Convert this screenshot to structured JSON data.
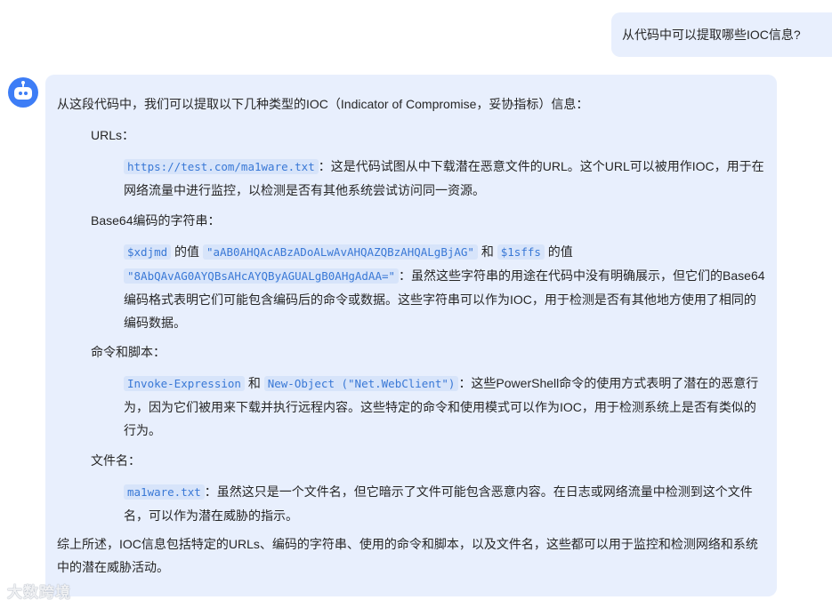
{
  "user_message": "从代码中可以提取哪些IOC信息?",
  "reply": {
    "intro": "从这段代码中，我们可以提取以下几种类型的IOC（Indicator of Compromise，妥协指标）信息：",
    "sections": [
      {
        "heading": "URLs：",
        "code1": "https://test.com/ma1ware.txt",
        "text1": "：这是代码试图从中下载潜在恶意文件的URL。这个URL可以被用作IOC，用于在网络流量中进行监控，以检测是否有其他系统尝试访问同一资源。"
      },
      {
        "heading": "Base64编码的字符串：",
        "code1": "$xdjmd",
        "text1": " 的值 ",
        "code2": "\"aAB0AHQAcABzADoALwAvAHQAZQBzAHQALgBjAG\"",
        "text2": " 和 ",
        "code3": "$1sffs",
        "text3": " 的值 ",
        "code4": "\"8AbQAvAG0AYQBsAHcAYQByAGUALgB0AHgAdAA=\"",
        "text4": "：虽然这些字符串的用途在代码中没有明确展示，但它们的Base64编码格式表明它们可能包含编码后的命令或数据。这些字符串可以作为IOC，用于检测是否有其他地方使用了相同的编码数据。"
      },
      {
        "heading": "命令和脚本：",
        "code1": "Invoke-Expression",
        "text1": " 和 ",
        "code2": "New-Object (\"Net.WebClient\")",
        "text2": "：这些PowerShell命令的使用方式表明了潜在的恶意行为，因为它们被用来下载并执行远程内容。这些特定的命令和使用模式可以作为IOC，用于检测系统上是否有类似的行为。"
      },
      {
        "heading": "文件名：",
        "code1": "ma1ware.txt",
        "text1": "：虽然这只是一个文件名，但它暗示了文件可能包含恶意内容。在日志或网络流量中检测到这个文件名，可以作为潜在威胁的指示。"
      }
    ],
    "summary": "综上所述，IOC信息包括特定的URLs、编码的字符串、使用的命令和脚本，以及文件名，这些都可以用于监控和检测网络和系统中的潜在威胁活动。"
  },
  "watermark": "大数跨境",
  "colors": {
    "bubble_bg": "#e8effd",
    "avatar": "#3d7df6",
    "code_text": "#3978d6",
    "code_bg": "#d7e4fa"
  },
  "icons": {
    "avatar": "robot-icon"
  }
}
